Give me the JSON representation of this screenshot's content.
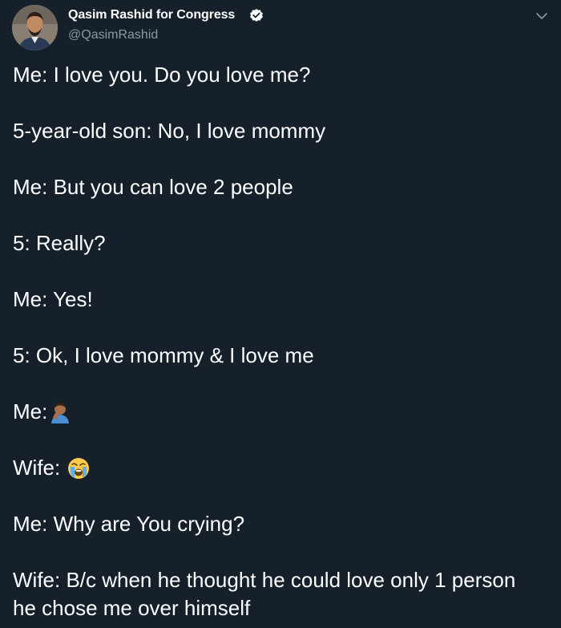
{
  "author": {
    "display_name": "Qasim Rashid for Congress",
    "handle": "@QasimRashid",
    "verified": true
  },
  "icons": {
    "verified": "verified-badge-icon",
    "menu": "chevron-down-icon",
    "facepalm": "man-facepalming-emoji",
    "crying": "loudly-crying-face-emoji"
  },
  "colors": {
    "background": "#15202b",
    "text": "#ffffff",
    "secondary_text": "#8899a6"
  },
  "tweet": {
    "lines": [
      "Me: I love you. Do you love me?",
      "5-year-old son: No, I love mommy",
      "Me: But you can love 2 people",
      "5: Really?",
      "Me: Yes!",
      "5: Ok, I love mommy & I love me",
      "Me:",
      "Wife:",
      "Me: Why are You crying?",
      "Wife: B/c when he thought he could love only 1 person",
      "he chose me over himself"
    ]
  }
}
